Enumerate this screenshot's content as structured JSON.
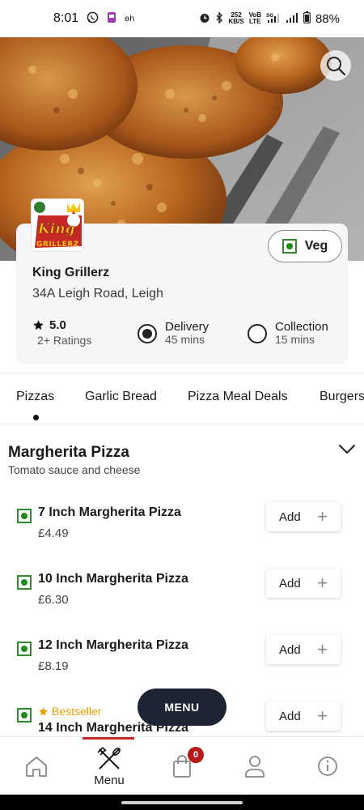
{
  "status_bar": {
    "time": "8:01",
    "network_speed_top": "252",
    "network_speed_bottom": "KB/S",
    "volte_top": "VoB",
    "volte_bottom": "LTE",
    "battery": "88%"
  },
  "restaurant": {
    "logo_text_top": "King",
    "logo_text_bottom": "GRILLERZ",
    "name": "King Grillerz",
    "address": "34A Leigh Road, Leigh",
    "rating": "5.0",
    "ratings_count": "2+ Ratings",
    "veg_toggle_label": "Veg"
  },
  "order_options": [
    {
      "title": "Delivery",
      "subtitle": "45 mins",
      "selected": true
    },
    {
      "title": "Collection",
      "subtitle": "15 mins",
      "selected": false
    }
  ],
  "category_tabs": [
    {
      "label": "Pizzas",
      "active": true
    },
    {
      "label": "Garlic Bread",
      "active": false
    },
    {
      "label": "Pizza Meal Deals",
      "active": false
    },
    {
      "label": "Burgers",
      "active": false
    }
  ],
  "section": {
    "title": "Margherita Pizza",
    "subtitle": "Tomato sauce and cheese"
  },
  "menu_items": [
    {
      "name": "7 Inch Margherita Pizza",
      "price": "£4.49",
      "add_label": "Add"
    },
    {
      "name": "10 Inch Margherita Pizza",
      "price": "£6.30",
      "add_label": "Add"
    },
    {
      "name": "12 Inch Margherita Pizza",
      "price": "£8.19",
      "add_label": "Add"
    },
    {
      "name": "14 Inch Margherita Pizza",
      "badge": "Bestseller",
      "add_label": "Add"
    }
  ],
  "menu_fab_label": "MENU",
  "bottom_nav": {
    "menu_label": "Menu",
    "cart_count": "0"
  },
  "colors": {
    "veg_green": "#1f8a1f",
    "bestseller": "#e8a000",
    "fab_bg": "#1d2433",
    "active_bar": "#c62828",
    "badge": "#b71c1c"
  }
}
